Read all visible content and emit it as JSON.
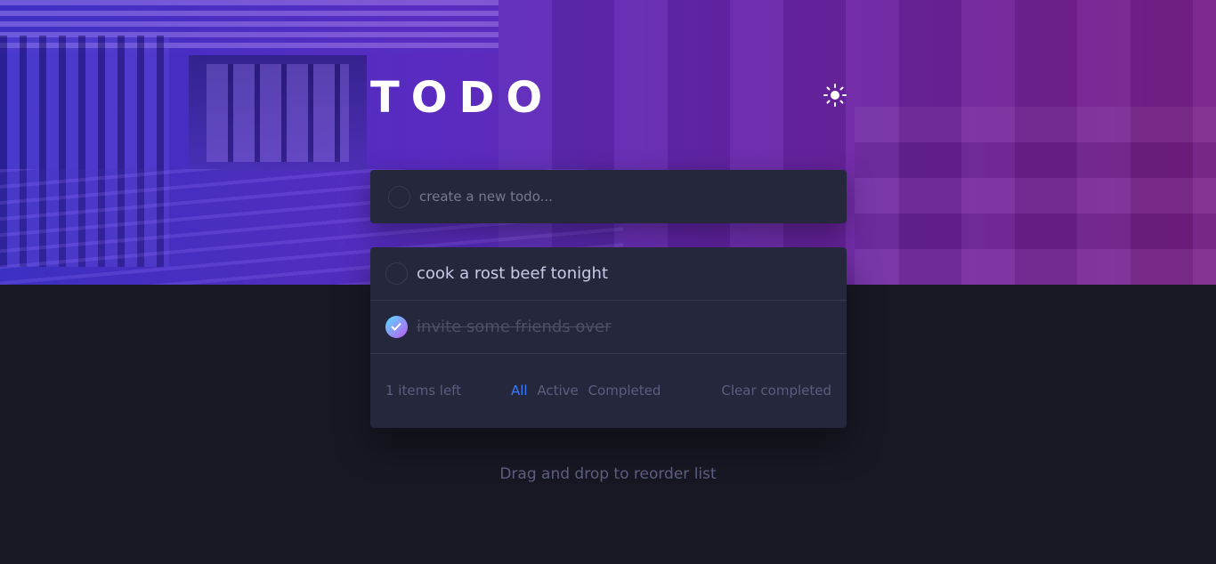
{
  "app": {
    "title": "TODO",
    "theme_icon": "sun-icon",
    "colors": {
      "background": "#181824",
      "card": "#25273c",
      "accent": "#3a7cfd",
      "check_gradient_start": "#55ddff",
      "check_gradient_end": "#c058f3"
    }
  },
  "new_todo": {
    "placeholder": "create a new todo...",
    "value": ""
  },
  "todos": [
    {
      "text": "cook a rost beef tonight",
      "completed": false
    },
    {
      "text": "invite some friends over",
      "completed": true
    }
  ],
  "footer": {
    "items_left": "1 items left",
    "filters": [
      "All",
      "Active",
      "Completed"
    ],
    "active_filter": "All",
    "clear_label": "Clear completed"
  },
  "hint": "Drag and drop to reorder list"
}
